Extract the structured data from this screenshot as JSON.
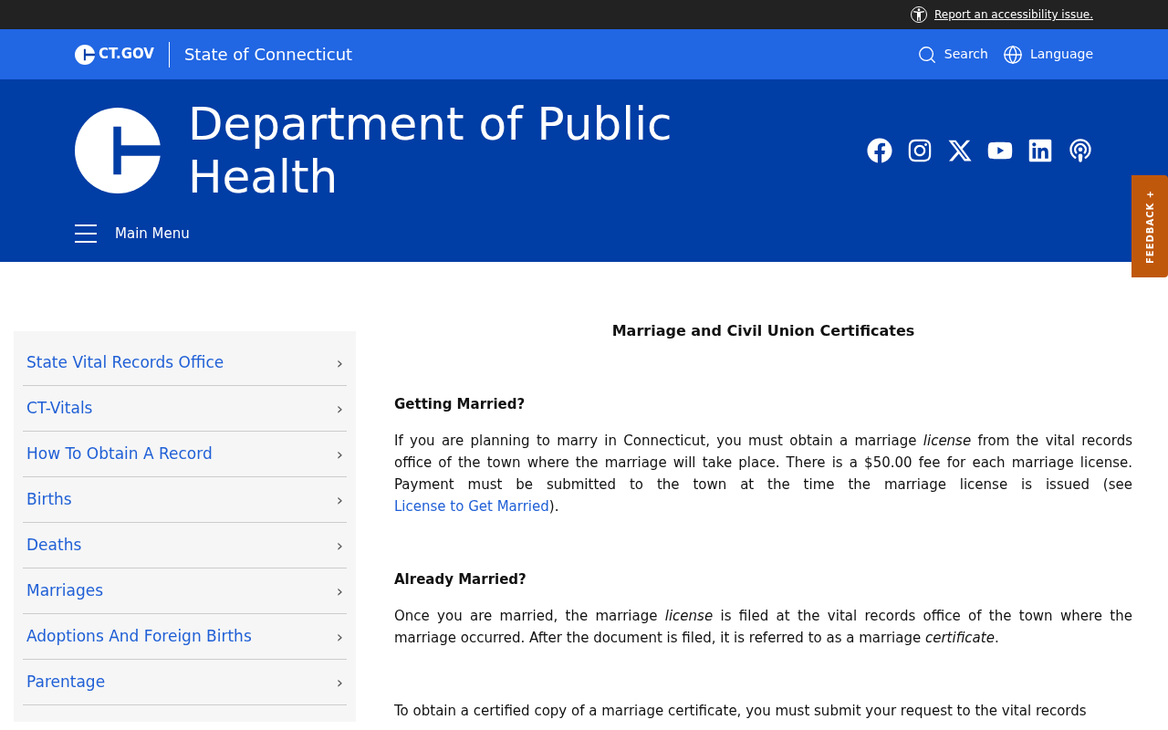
{
  "utility_bar": {
    "link": "Report an accessibility issue."
  },
  "top_nav": {
    "brand": "CT.GOV",
    "state": "State of Connecticut",
    "actions": [
      {
        "kind": "search",
        "label": "Search"
      },
      {
        "kind": "language",
        "label": "Language"
      }
    ]
  },
  "header": {
    "title": "Department of Public Health",
    "menu": "Main Menu"
  },
  "feedback": "FEEDBACK +",
  "sidebar": {
    "items": [
      {
        "label": "State Vital Records Office",
        "arrow": "›"
      },
      {
        "label": "CT-Vitals",
        "arrow": "›"
      },
      {
        "label": "How To Obtain A Record",
        "arrow": "›"
      },
      {
        "label": "Births",
        "arrow": "›"
      },
      {
        "label": "Deaths",
        "arrow": "›"
      },
      {
        "label": "Marriages",
        "arrow": "›"
      },
      {
        "label": "Adoptions And Foreign Births",
        "arrow": "›"
      },
      {
        "label": "Parentage",
        "arrow": "›"
      }
    ]
  },
  "content": {
    "title": "Marriage and Civil Union Certificates",
    "blocks": [
      {
        "kind": "heading",
        "text": "Getting Married?"
      },
      {
        "kind": "paragraph",
        "segments": [
          {
            "kind": "text",
            "text": "If you are planning to marry in Connecticut, you must obtain a marriage *license* from the vital records office of the town where the marriage will take place. There is a $50.00 fee for each marriage license. Payment must be submitted to the town at the time the marriage license is issued (see "
          },
          {
            "kind": "link",
            "text": "License to Get Married"
          },
          {
            "kind": "text",
            "text": ")."
          }
        ]
      },
      {
        "kind": "heading",
        "text": "Already Married?"
      },
      {
        "kind": "paragraph",
        "segments": [
          {
            "kind": "text",
            "text": "Once you are married, the marriage *license* is filed at the vital records office of the town where the marriage occurred. After the document is filed, it is referred to as a marriage *certificate*."
          }
        ]
      },
      {
        "kind": "paragraph",
        "segments": [
          {
            "kind": "text",
            "text": "To obtain a certified copy of a marriage certificate, you must submit your request to the vital records"
          }
        ]
      }
    ]
  }
}
